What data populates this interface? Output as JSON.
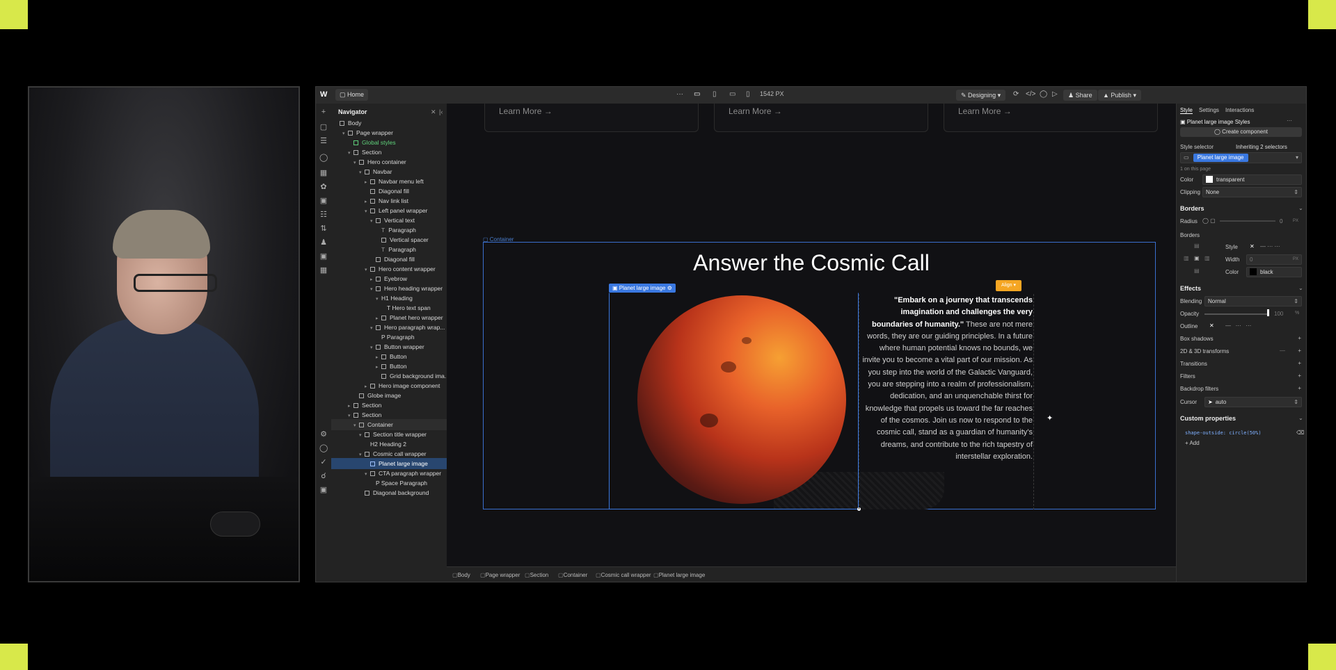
{
  "topbar": {
    "logo": "W",
    "page": "Home",
    "more": "···",
    "viewport_width": "1542 PX",
    "mode": "Designing",
    "share": "Share",
    "publish": "Publish"
  },
  "navigator": {
    "title": "Navigator",
    "items": [
      {
        "label": "Body"
      },
      {
        "label": "Page wrapper"
      },
      {
        "label": "Global styles"
      },
      {
        "label": "Section"
      },
      {
        "label": "Hero container"
      },
      {
        "label": "Navbar"
      },
      {
        "label": "Navbar menu left"
      },
      {
        "label": "Diagonal fill"
      },
      {
        "label": "Nav link list"
      },
      {
        "label": "Left panel wrapper"
      },
      {
        "label": "Vertical text"
      },
      {
        "label": "Paragraph"
      },
      {
        "label": "Vertical spacer"
      },
      {
        "label": "Paragraph"
      },
      {
        "label": "Diagonal fill"
      },
      {
        "label": "Hero content wrapper"
      },
      {
        "label": "Eyebrow"
      },
      {
        "label": "Hero heading wrapper"
      },
      {
        "label": "H1 Heading"
      },
      {
        "label": "T Hero text span"
      },
      {
        "label": "Planet hero wrapper"
      },
      {
        "label": "Hero paragraph wrap..."
      },
      {
        "label": "P Paragraph"
      },
      {
        "label": "Button wrapper"
      },
      {
        "label": "Button"
      },
      {
        "label": "Button"
      },
      {
        "label": "Grid background ima..."
      },
      {
        "label": "Hero image component"
      },
      {
        "label": "Globe image"
      },
      {
        "label": "Section"
      },
      {
        "label": "Section"
      },
      {
        "label": "Container"
      },
      {
        "label": "Section title wrapper"
      },
      {
        "label": "H2 Heading 2"
      },
      {
        "label": "Cosmic call wrapper"
      },
      {
        "label": "Planet large image"
      },
      {
        "label": "CTA paragraph wrapper"
      },
      {
        "label": "P Space Paragraph"
      },
      {
        "label": "Diagonal background"
      }
    ]
  },
  "canvas": {
    "cards": [
      "Learn More →",
      "Learn More →",
      "Learn More →"
    ],
    "container_label": "Container",
    "heading": "Answer the Cosmic Call",
    "selected_tag": "Planet large image",
    "align_badge": "Align",
    "paragraph_lead": "\"Embark on a journey that transcends imagination and challenges the very boundaries of humanity.\"",
    "paragraph_rest": " These are not mere words, they are our guiding principles. In a future where human potential knows no bounds, we invite you to become a vital part of our mission. As you step into the world of the Galactic Vanguard, you are stepping into a realm of professionalism, dedication, and an unquenchable thirst for knowledge that propels us toward the far reaches of the cosmos. Join us now to respond to the cosmic call, stand as a guardian of humanity's dreams, and contribute to the rich tapestry of interstellar exploration."
  },
  "breadcrumbs": [
    "Body",
    "Page wrapper",
    "Section",
    "Container",
    "Cosmic call wrapper",
    "Planet large image"
  ],
  "style_panel": {
    "tabs": [
      "Style",
      "Settings",
      "Interactions"
    ],
    "element_styles": "Planet large image Styles",
    "create_component": "Create component",
    "style_selector_label": "Style selector",
    "inheriting": "Inheriting 2 selectors",
    "selector_chip": "Planet large image",
    "on_page": "1 on this page",
    "color_label": "Color",
    "color_value": "transparent",
    "clipping_label": "Clipping",
    "clipping_value": "None",
    "borders_title": "Borders",
    "radius_label": "Radius",
    "radius_value": "0",
    "radius_unit": "PX",
    "borders_sub": "Borders",
    "style_label": "Style",
    "width_label": "Width",
    "width_value": "0",
    "width_unit": "PX",
    "border_color_label": "Color",
    "border_color_value": "black",
    "effects_title": "Effects",
    "blending_label": "Blending",
    "blending_value": "Normal",
    "opacity_label": "Opacity",
    "opacity_value": "100",
    "opacity_unit": "%",
    "outline_label": "Outline",
    "box_shadows": "Box shadows",
    "transforms": "2D & 3D transforms",
    "transitions": "Transitions",
    "filters": "Filters",
    "backdrop_filters": "Backdrop filters",
    "cursor_label": "Cursor",
    "cursor_value": "auto",
    "custom_props_title": "Custom properties",
    "custom_prop": "shape-outside: circle(50%)",
    "add_label": "+ Add"
  },
  "colors": {
    "accent_blue": "#3a78e0",
    "align_orange": "#f5a623",
    "corner_marker": "#d8e84a"
  }
}
